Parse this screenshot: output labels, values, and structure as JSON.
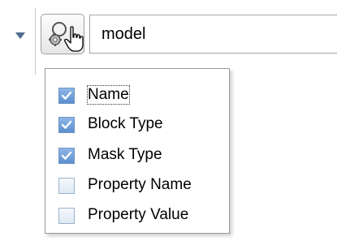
{
  "search": {
    "value": "model"
  },
  "icons": {
    "collapse": "triangle-down-icon",
    "options_button": "search-gear-icon",
    "cursor": "hand-pointer-icon"
  },
  "menu": {
    "items": [
      {
        "label": "Name",
        "checked": true,
        "focused": true
      },
      {
        "label": "Block Type",
        "checked": true,
        "focused": false
      },
      {
        "label": "Mask Type",
        "checked": true,
        "focused": false
      },
      {
        "label": "Property Name",
        "checked": false,
        "focused": false
      },
      {
        "label": "Property Value",
        "checked": false,
        "focused": false
      }
    ]
  },
  "colors": {
    "check_fill": "#5b8fcf",
    "arrow": "#4d6a8e"
  }
}
